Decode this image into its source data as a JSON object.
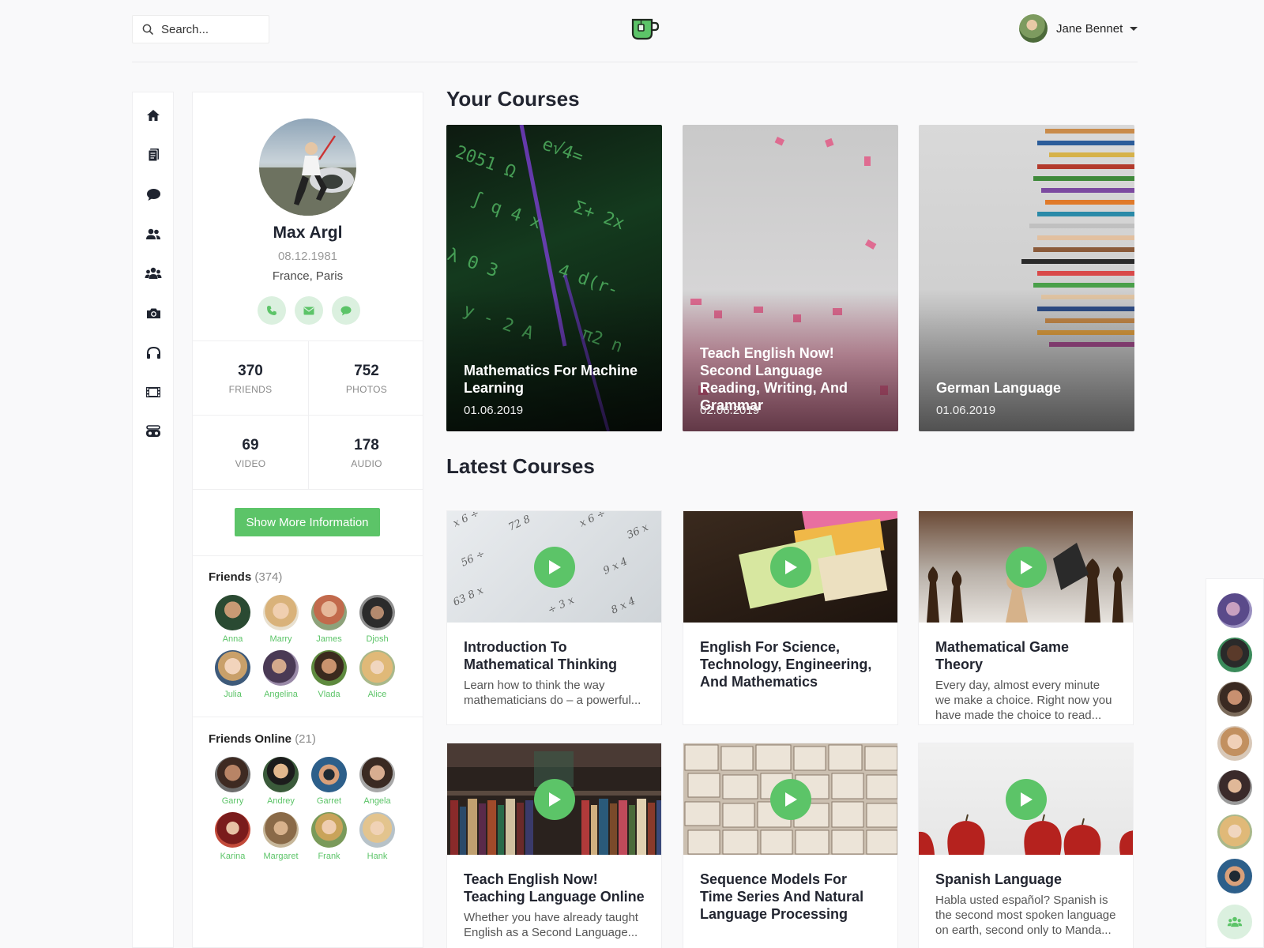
{
  "header": {
    "search_placeholder": "Search...",
    "logo_icon": "coffee-cup-logo",
    "user_name": "Jane Bennet"
  },
  "nav_icons": [
    "home-icon",
    "document-icon",
    "chat-icon",
    "friends-icon",
    "groups-icon",
    "camera-icon",
    "headphones-icon",
    "film-icon",
    "gamepad-icon"
  ],
  "profile": {
    "name": "Max Argl",
    "birthdate": "08.12.1981",
    "location": "France, Paris",
    "stats": {
      "friends_value": "370",
      "friends_label": "FRIENDS",
      "photos_value": "752",
      "photos_label": "PHOTOS",
      "video_value": "69",
      "video_label": "VIDEO",
      "audio_value": "178",
      "audio_label": "AUDIO"
    },
    "more_button": "Show More Information",
    "friends_title": "Friends",
    "friends_count": "(374)",
    "friends": [
      "Anna",
      "Marry",
      "James",
      "Djosh",
      "Julia",
      "Angelina",
      "Vlada",
      "Alice"
    ],
    "online_title": "Friends Online",
    "online_count": "(21)",
    "online": [
      "Garry",
      "Andrey",
      "Garret",
      "Angela",
      "Karina",
      "Margaret",
      "Frank",
      "Hank"
    ]
  },
  "your_courses": {
    "title": "Your Courses",
    "items": [
      {
        "title": "Mathematics For Machine Learning",
        "date": "01.06.2019"
      },
      {
        "title": "Teach English Now! Second Language Reading, Writing, And Grammar",
        "date": "02.06.2019"
      },
      {
        "title": "German Language",
        "date": "01.06.2019"
      }
    ]
  },
  "latest_courses": {
    "title": "Latest Courses",
    "items": [
      {
        "title": "Introduction To Mathematical Thinking",
        "desc": "Learn how to think the way mathematicians do – a powerful..."
      },
      {
        "title": "English For Science, Technology, Engineering, And Mathematics",
        "desc": ""
      },
      {
        "title": "Mathematical Game Theory",
        "desc": "Every day, almost every minute we make a choice. Right now you have made the choice to read..."
      },
      {
        "title": "Teach English Now! Teaching Language Online",
        "desc": "Whether you have already taught English as a Second Language..."
      },
      {
        "title": "Sequence Models For Time Series And Natural Language Processing",
        "desc": ""
      },
      {
        "title": "Spanish Language",
        "desc": "Habla usted español? Spanish is the second most spoken language on earth, second only to Manda..."
      }
    ]
  },
  "colors": {
    "accent": "#5cc468",
    "accent_light": "#dbf0df",
    "text_dark": "#222530",
    "background": "#f9f9fa"
  }
}
